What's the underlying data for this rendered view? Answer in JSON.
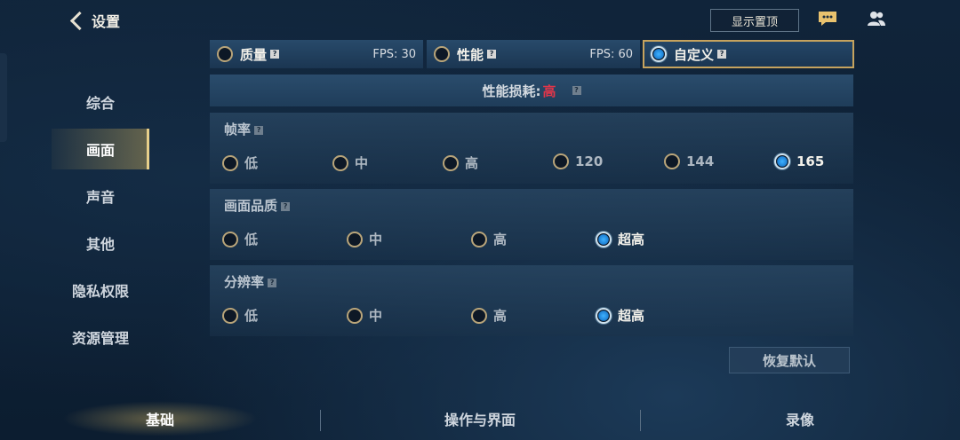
{
  "header": {
    "back_label": "设置",
    "pin_label": "显示置顶",
    "icons": [
      "chat-icon",
      "friends-icon"
    ]
  },
  "sidebar": {
    "items": [
      {
        "label": "综合"
      },
      {
        "label": "画面",
        "active": true
      },
      {
        "label": "声音"
      },
      {
        "label": "其他"
      },
      {
        "label": "隐私权限"
      },
      {
        "label": "资源管理"
      }
    ]
  },
  "presets": [
    {
      "label": "质量",
      "fps": "FPS: 30",
      "selected": false
    },
    {
      "label": "性能",
      "fps": "FPS: 60",
      "selected": false
    },
    {
      "label": "自定义",
      "fps": "",
      "selected": true
    }
  ],
  "perf": {
    "label": "性能损耗:",
    "value": "高"
  },
  "framerate": {
    "title": "帧率",
    "options": [
      "低",
      "中",
      "高",
      "120",
      "144",
      "165"
    ],
    "selected": "165"
  },
  "quality": {
    "title": "画面品质",
    "options": [
      "低",
      "中",
      "高",
      "超高"
    ],
    "selected": "超高"
  },
  "resolution": {
    "title": "分辨率",
    "options": [
      "低",
      "中",
      "高",
      "超高"
    ],
    "selected": "超高"
  },
  "reset_label": "恢复默认",
  "bottom_tabs": [
    {
      "label": "基础",
      "active": true
    },
    {
      "label": "操作与界面"
    },
    {
      "label": "录像"
    }
  ],
  "colors": {
    "accent_gold": "#c6a35e",
    "loss_high": "#e0364a",
    "radio_on": "#3fb2ff"
  }
}
